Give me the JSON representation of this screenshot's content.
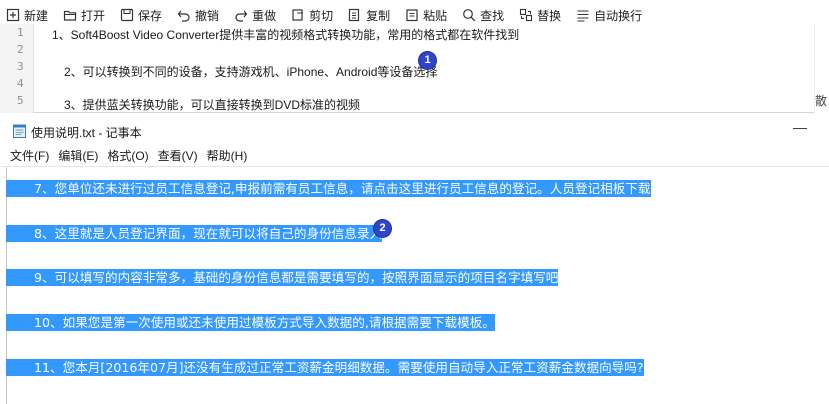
{
  "toolbar": {
    "buttons": [
      {
        "label": "新建",
        "icon": "new-file-icon"
      },
      {
        "label": "打开",
        "icon": "folder-open-icon"
      },
      {
        "label": "保存",
        "icon": "save-icon"
      },
      {
        "label": "撤销",
        "icon": "undo-icon"
      },
      {
        "label": "重做",
        "icon": "redo-icon"
      },
      {
        "label": "剪切",
        "icon": "cut-icon"
      },
      {
        "label": "复制",
        "icon": "copy-icon"
      },
      {
        "label": "粘贴",
        "icon": "paste-icon"
      },
      {
        "label": "查找",
        "icon": "search-icon"
      },
      {
        "label": "替换",
        "icon": "replace-icon"
      },
      {
        "label": "自动换行",
        "icon": "word-wrap-icon"
      }
    ]
  },
  "editor": {
    "line_numbers": [
      "1",
      "2",
      "3",
      "4",
      "5"
    ],
    "lines": [
      "1、Soft4Boost Video Converter提供丰富的视频格式转换功能，常用的格式都在软件找到",
      "2、可以转换到不同的设备，支持游戏机、iPhone、Android等设备选择",
      "3、提供蓝关转换功能，可以直接转换到DVD标准的视频"
    ],
    "side_glyph": "散"
  },
  "badges": [
    "1",
    "2"
  ],
  "notepad": {
    "title": "使用说明.txt - 记事本",
    "minimize_glyph": "—",
    "menu": [
      "文件(F)",
      "编辑(E)",
      "格式(O)",
      "查看(V)",
      "帮助(H)"
    ],
    "lines": [
      "7、您单位还未进行过员工信息登记,申报前需有员工信息，请点击这里进行员工信息的登记。人员登记相板下载",
      "8、这里就是人员登记界面，现在就可以将自己的身份信息录入",
      "9、可以填写的内容非常多，基础的身份信息都是需要填写的，按照界面显示的项目名字填写吧",
      "10、如果您是第一次使用或还未使用过模板方式导入数据的,请根据需要下载模板。",
      "11、您本月[2016年07月]还没有生成过正常工资薪金明细数据。需要使用自动导入正常工资薪金数据向导吗?"
    ]
  },
  "colors": {
    "selection": "#3399ff",
    "badge": "#2e45c8",
    "gutter": "#f3f3f3"
  }
}
